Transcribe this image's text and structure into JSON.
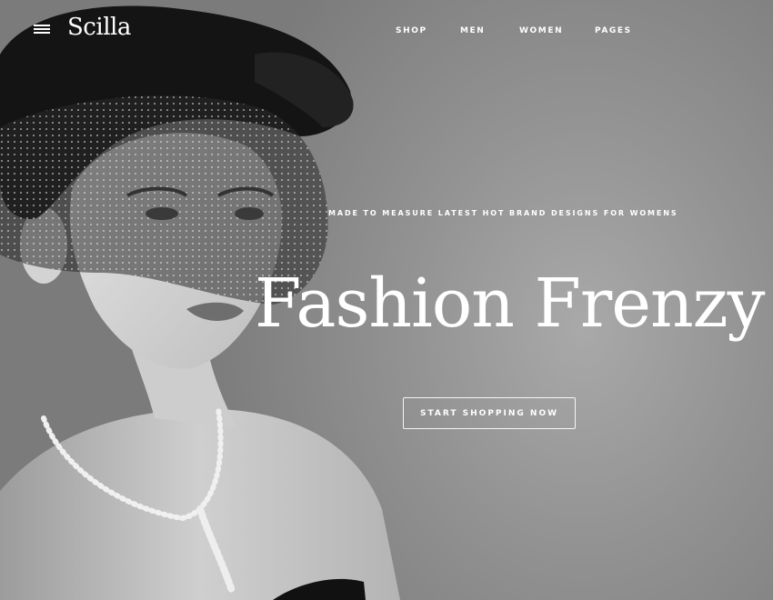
{
  "header": {
    "logo": "Scilla",
    "menu_icon": "hamburger-menu-icon",
    "nav": [
      {
        "label": "SHOP"
      },
      {
        "label": "MEN"
      },
      {
        "label": "WOMEN"
      },
      {
        "label": "PAGES"
      }
    ]
  },
  "hero": {
    "tagline": "MADE TO MEASURE LATEST HOT BRAND DESIGNS FOR WOMENS",
    "headline": "Fashion Frenzy",
    "cta_label": "START SHOPPING NOW"
  }
}
